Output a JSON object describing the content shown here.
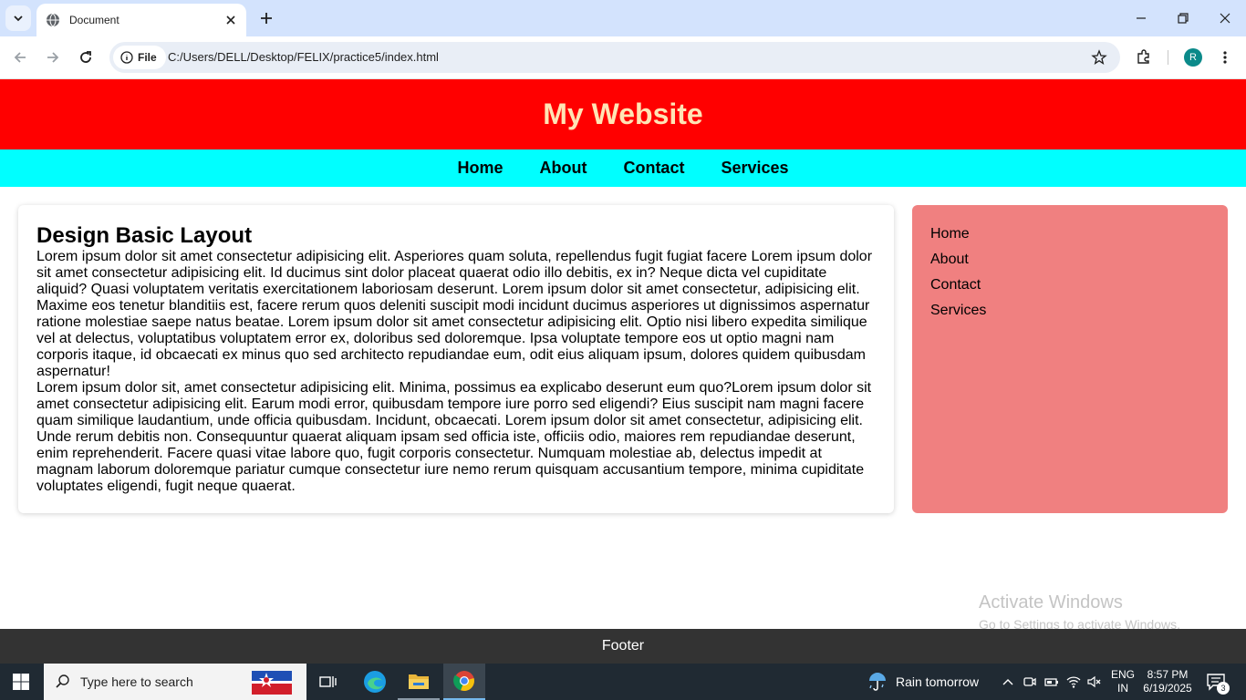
{
  "browser": {
    "tab_title": "Document",
    "url_chip": "File",
    "url": "C:/Users/DELL/Desktop/FELIX/practice5/index.html",
    "profile_initial": "R"
  },
  "site": {
    "title": "My Website",
    "nav": [
      "Home",
      "About",
      "Contact",
      "Services"
    ],
    "main": {
      "heading": "Design Basic Layout",
      "paragraphs": [
        "Lorem ipsum dolor sit amet consectetur adipisicing elit. Asperiores quam soluta, repellendus fugit fugiat facere Lorem ipsum dolor sit amet consectetur adipisicing elit. Id ducimus sint dolor placeat quaerat odio illo debitis, ex in? Neque dicta vel cupiditate aliquid? Quasi voluptatem veritatis exercitationem laboriosam deserunt. Lorem ipsum dolor sit amet consectetur, adipisicing elit. Maxime eos tenetur blanditiis est, facere rerum quos deleniti suscipit modi incidunt ducimus asperiores ut dignissimos aspernatur ratione molestiae saepe natus beatae. Lorem ipsum dolor sit amet consectetur adipisicing elit. Optio nisi libero expedita similique vel at delectus, voluptatibus voluptatem error ex, doloribus sed doloremque. Ipsa voluptate tempore eos ut optio magni nam corporis itaque, id obcaecati ex minus quo sed architecto repudiandae eum, odit eius aliquam ipsum, dolores quidem quibusdam aspernatur!",
        "Lorem ipsum dolor sit, amet consectetur adipisicing elit. Minima, possimus ea explicabo deserunt eum quo?Lorem ipsum dolor sit amet consectetur adipisicing elit. Earum modi error, quibusdam tempore iure porro sed eligendi? Eius suscipit nam magni facere quam similique laudantium, unde officia quibusdam. Incidunt, obcaecati. Lorem ipsum dolor sit amet consectetur, adipisicing elit. Unde rerum debitis non. Consequuntur quaerat aliquam ipsam sed officia iste, officiis odio, maiores rem repudiandae deserunt, enim reprehenderit. Facere quasi vitae labore quo, fugit corporis consectetur. Numquam molestiae ab, delectus impedit at magnam laborum doloremque pariatur cumque consectetur iure nemo rerum quisquam accusantium tempore, minima cupiditate voluptates eligendi, fugit neque quaerat."
      ]
    },
    "aside": [
      "Home",
      "About",
      "Contact",
      "Services"
    ],
    "footer": "Footer"
  },
  "watermark": {
    "line1": "Activate Windows",
    "line2": "Go to Settings to activate Windows."
  },
  "taskbar": {
    "search_placeholder": "Type here to search",
    "weather": "Rain tomorrow",
    "lang_top": "ENG",
    "lang_bottom": "IN",
    "time": "8:57 PM",
    "date": "6/19/2025",
    "notification_count": "3"
  },
  "colors": {
    "header_bg": "#ff0000",
    "header_text": "#ffe4b5",
    "nav_bg": "#00ffff",
    "aside_bg": "#f08080",
    "footer_bg": "#333333"
  }
}
